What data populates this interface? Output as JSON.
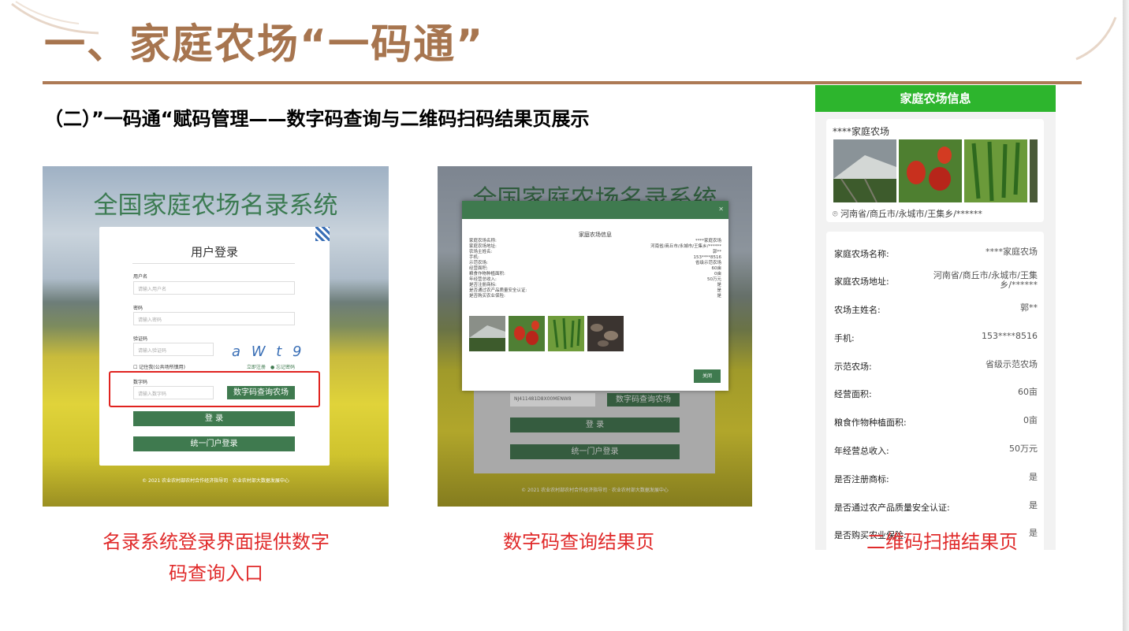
{
  "slide": {
    "title": "一、家庭农场“一码通”",
    "subtitle": "（二）”一码通“赋码管理——数字码查询与二维码扫码结果页展示"
  },
  "login_page": {
    "system_title": "全国家庭农场名录系统",
    "card_title": "用户登录",
    "username_label": "用户名",
    "username_placeholder": "请输入用户名",
    "password_label": "密码",
    "password_placeholder": "请输入密码",
    "captcha_label": "验证码",
    "captcha_placeholder": "请输入验证码",
    "captcha_text": "a W t 9",
    "remember_label": "记住我(公共场所慎用)",
    "register_link": "立即注册",
    "forgot_link": "忘记密码",
    "code_label": "数字码",
    "code_placeholder": "请输入数字码",
    "code_query_button": "数字码查询农场",
    "login_button": "登 录",
    "portal_login_button": "统一门户登录",
    "footer": "© 2021 农业农村部农村合作经济指导司 · 农业农村部大数据发展中心"
  },
  "query_result_page": {
    "system_title": "全国家庭农场名录系统",
    "modal_title": "家庭农场信息",
    "rows": [
      {
        "k": "家庭农场名称:",
        "v": "****家庭农场"
      },
      {
        "k": "家庭农场地址:",
        "v": "河南省/商丘市/永城市/王集乡/******"
      },
      {
        "k": "农场主姓名:",
        "v": "郭**"
      },
      {
        "k": "手机:",
        "v": "153****8516"
      },
      {
        "k": "示范农场:",
        "v": "省级示范农场"
      },
      {
        "k": "经营面积:",
        "v": "60亩"
      },
      {
        "k": "粮食作物种植面积:",
        "v": "0亩"
      },
      {
        "k": "年经营总收入:",
        "v": "50万元"
      },
      {
        "k": "是否注册商标:",
        "v": "是"
      },
      {
        "k": "是否通过农产品质量安全认证:",
        "v": "是"
      },
      {
        "k": "是否购买农业保险:",
        "v": "是"
      }
    ],
    "close_button": "关闭",
    "bg_code_value": "NJ411481D8X00MENW8",
    "bg_code_button": "数字码查询农场",
    "bg_login_button": "登 录",
    "bg_portal_button": "统一门户登录",
    "bg_footer": "© 2021 农业农村部农村合作经济指导司 · 农业农村部大数据发展中心"
  },
  "scan_result_page": {
    "header": "家庭农场信息",
    "farm_name": "****家庭农场",
    "address": "河南省/商丘市/永城市/王集乡/******",
    "rows": [
      {
        "k": "家庭农场名称:",
        "v": "****家庭农场"
      },
      {
        "k": "家庭农场地址:",
        "v": "河南省/商丘市/永城市/王集乡/******"
      },
      {
        "k": "农场主姓名:",
        "v": "郭**"
      },
      {
        "k": "手机:",
        "v": "153****8516"
      },
      {
        "k": "示范农场:",
        "v": "省级示范农场"
      },
      {
        "k": "经营面积:",
        "v": "60亩"
      },
      {
        "k": "粮食作物种植面积:",
        "v": "0亩"
      },
      {
        "k": "年经营总收入:",
        "v": "50万元"
      },
      {
        "k": "是否注册商标:",
        "v": "是"
      },
      {
        "k": "是否通过农产品质量安全认证:",
        "v": "是"
      },
      {
        "k": "是否购买农业保险:",
        "v": "是"
      }
    ]
  },
  "captions": {
    "left_line1": "名录系统登录界面提供数字",
    "left_line2": "码查询入口",
    "middle": "数字码查询结果页",
    "right": "二维码扫描结果页"
  },
  "colors": {
    "title_brown": "#a7754f",
    "system_green": "#3f7a4f",
    "phone_header_green": "#2db52d",
    "caption_red": "#e02b2b"
  }
}
